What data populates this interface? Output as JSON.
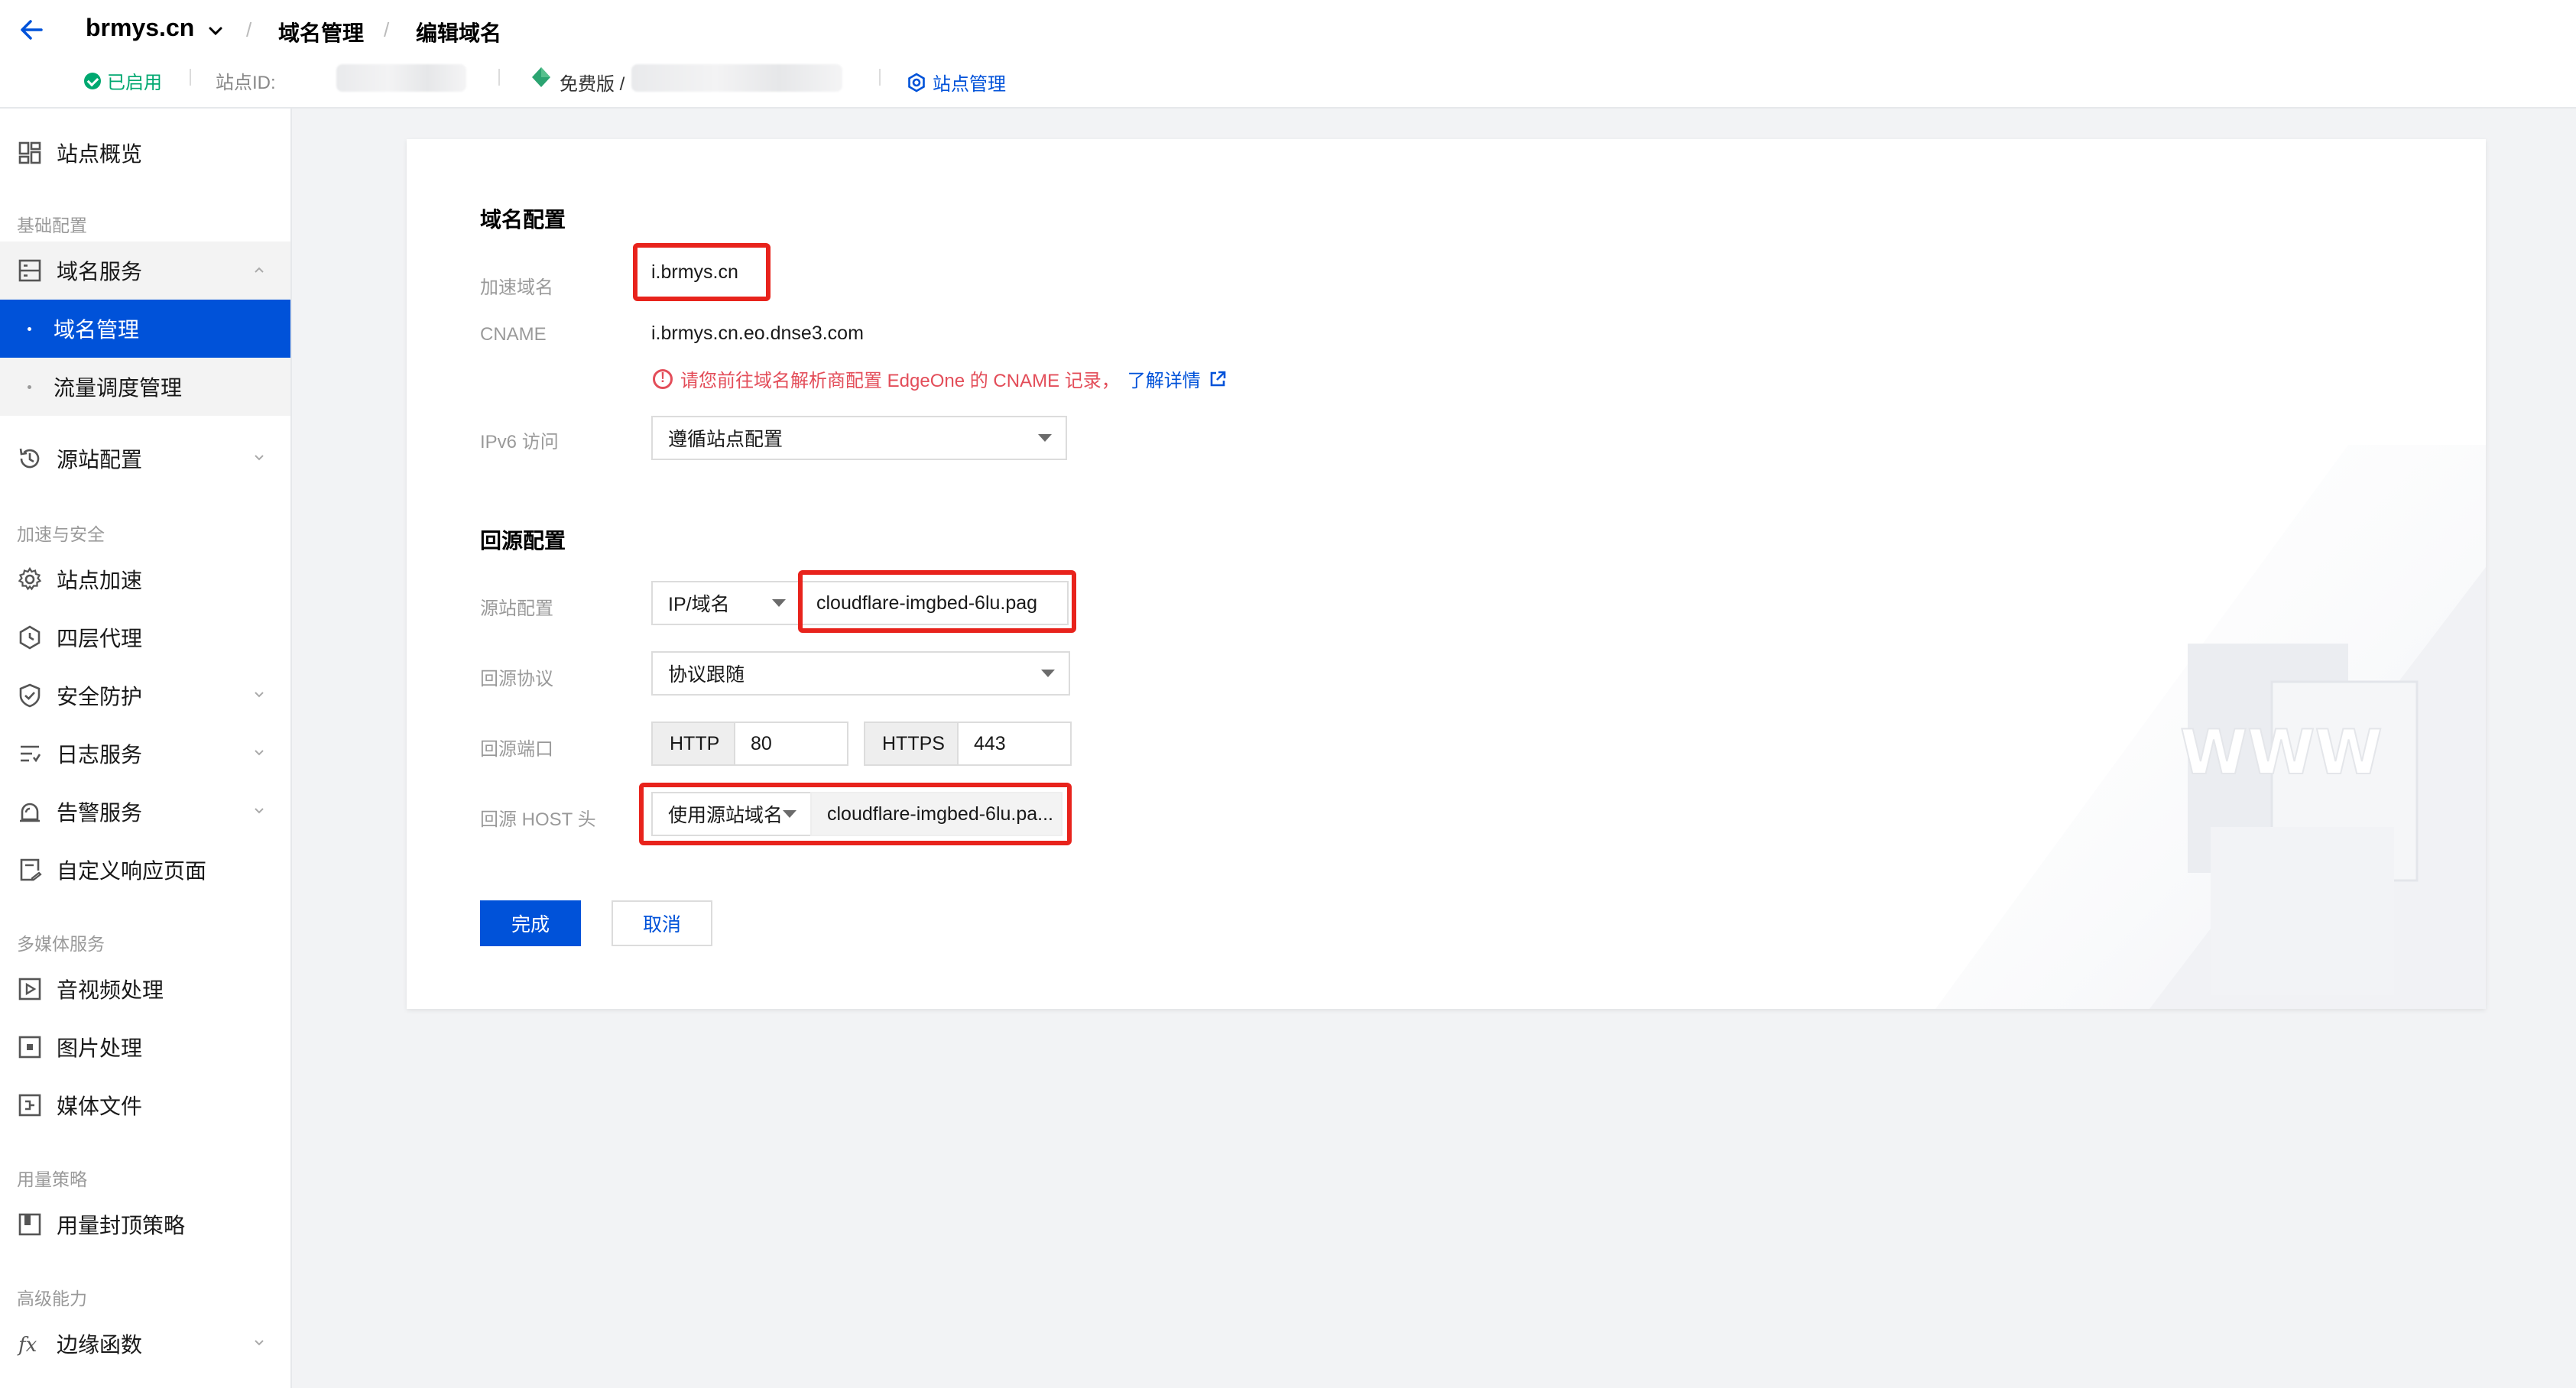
{
  "header": {
    "site_name": "brmys.cn",
    "crumbs": [
      "域名管理",
      "编辑域名"
    ],
    "status": "已启用",
    "site_id_label": "站点ID:",
    "plan": "免费版 /",
    "site_management": "站点管理"
  },
  "sidebar": {
    "overview": "站点概览",
    "sections": {
      "basic": "基础配置",
      "accel_security": "加速与安全",
      "media": "多媒体服务",
      "usage": "用量策略",
      "advanced": "高级能力"
    },
    "items": {
      "domain_service": "域名服务",
      "domain_management": "域名管理",
      "traffic_scheduling": "流量调度管理",
      "origin_config": "源站配置",
      "site_acceleration": "站点加速",
      "l4_proxy": "四层代理",
      "security": "安全防护",
      "log_service": "日志服务",
      "alarm_service": "告警服务",
      "custom_error_page": "自定义响应页面",
      "av_processing": "音视频处理",
      "image_processing": "图片处理",
      "media_files": "媒体文件",
      "usage_cap": "用量封顶策略",
      "edge_functions": "边缘函数"
    }
  },
  "form": {
    "domain_section_title": "域名配置",
    "accel_domain_label": "加速域名",
    "accel_domain_value": "i.brmys.cn",
    "cname_label": "CNAME",
    "cname_value": "i.brmys.cn.eo.dnse3.com",
    "cname_warning": "请您前往域名解析商配置 EdgeOne 的 CNAME 记录，",
    "learn_more": "了解详情",
    "ipv6_label": "IPv6 访问",
    "ipv6_value": "遵循站点配置",
    "origin_section_title": "回源配置",
    "origin_label": "源站配置",
    "origin_type": "IP/域名",
    "origin_value": "cloudflare-imgbed-6lu.pag",
    "protocol_label": "回源协议",
    "protocol_value": "协议跟随",
    "port_label": "回源端口",
    "http_label": "HTTP",
    "http_port": "80",
    "https_label": "HTTPS",
    "https_port": "443",
    "host_label": "回源 HOST 头",
    "host_type": "使用源站域名",
    "host_value": "cloudflare-imgbed-6lu.pa...",
    "submit": "完成",
    "cancel": "取消"
  },
  "colors": {
    "primary": "#0052d9",
    "success": "#00a870",
    "error": "#e34d59",
    "highlight_box": "#e8231c"
  }
}
